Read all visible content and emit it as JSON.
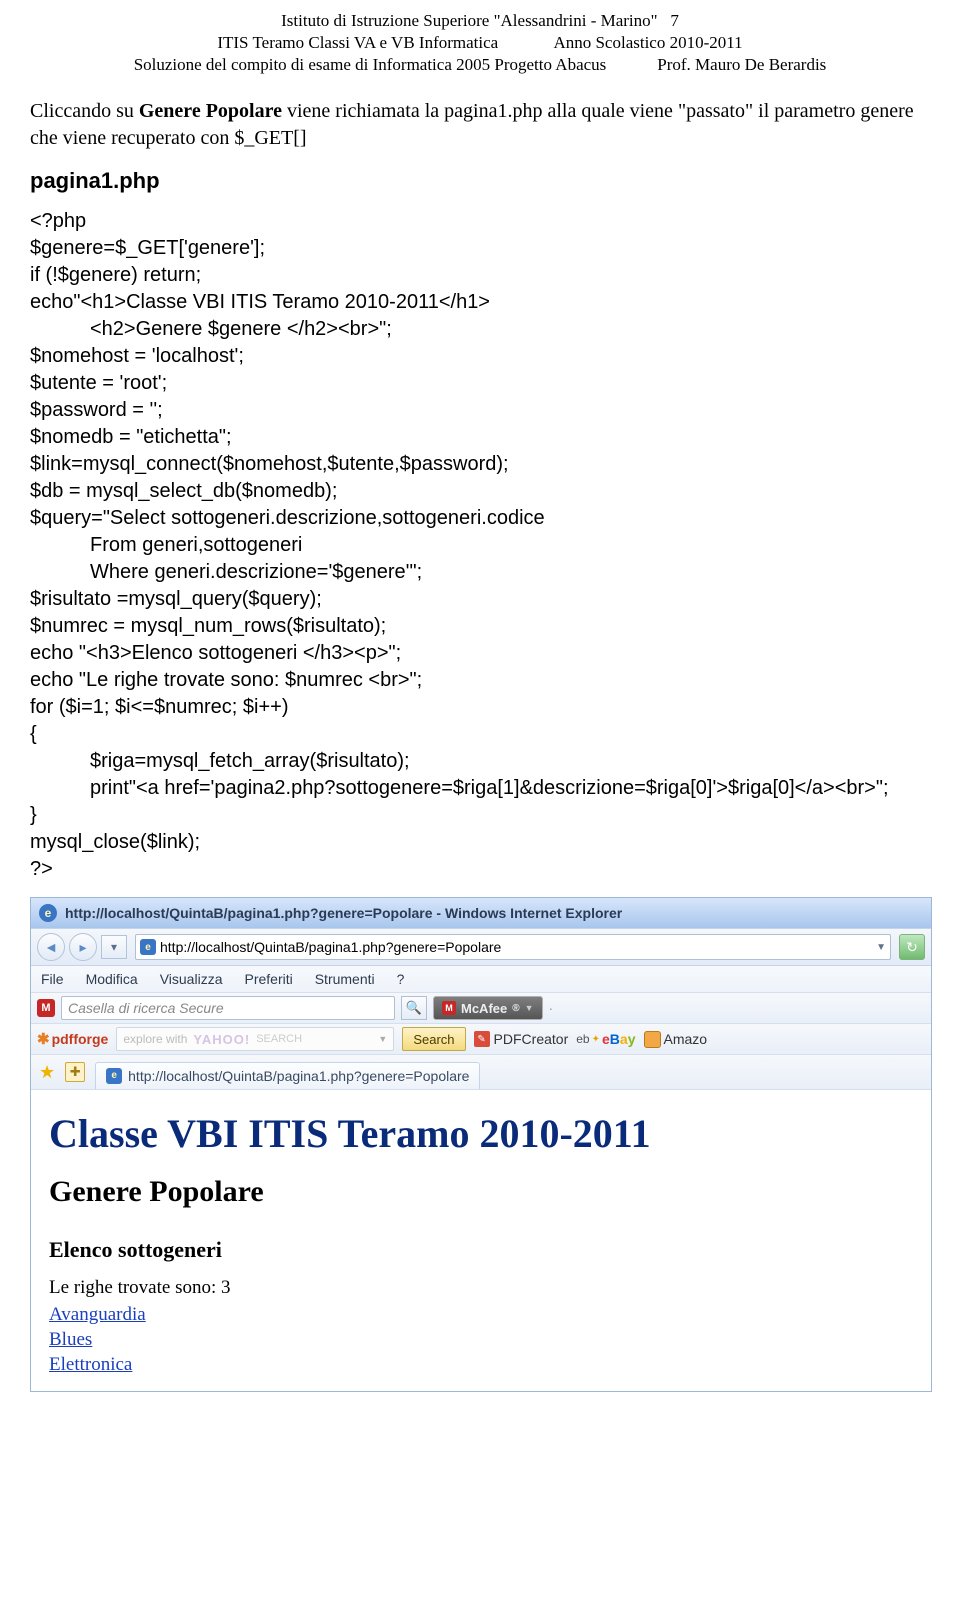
{
  "header": {
    "line1a": "Istituto di Istruzione Superiore \"Alessandrini - Marino\"",
    "line1b": "7",
    "line2a": "ITIS Teramo Classi VA e  VB Informatica",
    "line2b": "Anno Scolastico 2010-2011",
    "line3a": "Soluzione del compito di esame di Informatica 2005   Progetto  Abacus",
    "line3b": "Prof. Mauro De Berardis"
  },
  "para": {
    "pre1": "Cliccando su ",
    "b1": "Genere Popolare",
    "mid1": " viene richiamata la pagina1.php alla quale  viene \"passato\" il parametro genere che viene recuperato con $_GET[]"
  },
  "section_title": "pagina1.php",
  "code": {
    "l1": "<?php",
    "l2": "$genere=$_GET['genere'];",
    "l3": "if (!$genere) return;",
    "l4": "echo\"<h1>Classe VBI ITIS Teramo 2010-2011</h1>",
    "l5": "<h2>Genere $genere </h2><br>\";",
    "l6": "$nomehost = 'localhost';",
    "l7": "$utente = 'root';",
    "l8": "$password = '';",
    "l9": "$nomedb = \"etichetta\";",
    "l10": "$link=mysql_connect($nomehost,$utente,$password);",
    "l11": "$db = mysql_select_db($nomedb);",
    "l12": "$query=\"Select sottogeneri.descrizione,sottogeneri.codice",
    "l13": "From generi,sottogeneri",
    "l14": "Where generi.descrizione='$genere'\";",
    "l15": "$risultato =mysql_query($query);",
    "l16": "$numrec = mysql_num_rows($risultato);",
    "l17": "echo \"<h3>Elenco sottogeneri </h3><p>\";",
    "l18": "echo \"Le righe trovate sono: $numrec <br>\";",
    "l19": "for ($i=1; $i<=$numrec; $i++)",
    "l20": "{",
    "l21": "$riga=mysql_fetch_array($risultato);",
    "l22": "print\"<a href='pagina2.php?sottogenere=$riga[1]&descrizione=$riga[0]'>$riga[0]</a><br>\";",
    "l23": "}",
    "l24": "mysql_close($link);",
    "l25": "?>"
  },
  "browser": {
    "title": "http://localhost/QuintaB/pagina1.php?genere=Popolare - Windows Internet Explorer",
    "url": "http://localhost/QuintaB/pagina1.php?genere=Popolare",
    "menu": [
      "File",
      "Modifica",
      "Visualizza",
      "Preferiti",
      "Strumenti",
      "?"
    ],
    "secure_placeholder": "Casella di ricerca Secure",
    "mcafee": "McAfee",
    "pdfforge": "pdfforge",
    "y_explore": "explore with",
    "y_logo": "YAHOO!",
    "y_search_suffix": "SEARCH",
    "search_btn": "Search",
    "pdfcreator": "PDFCreator",
    "ebay_pre": "eb",
    "ebay": "eBay",
    "amazon": "Amazo",
    "tab": "http://localhost/QuintaB/pagina1.php?genere=Popolare",
    "content": {
      "h1": "Classe VBI ITIS Teramo 2010-2011",
      "h2": "Genere Popolare",
      "h3": "Elenco sottogeneri",
      "rows": "Le righe trovate sono: 3",
      "links": [
        "Avanguardia",
        "Blues",
        "Elettronica"
      ]
    }
  }
}
